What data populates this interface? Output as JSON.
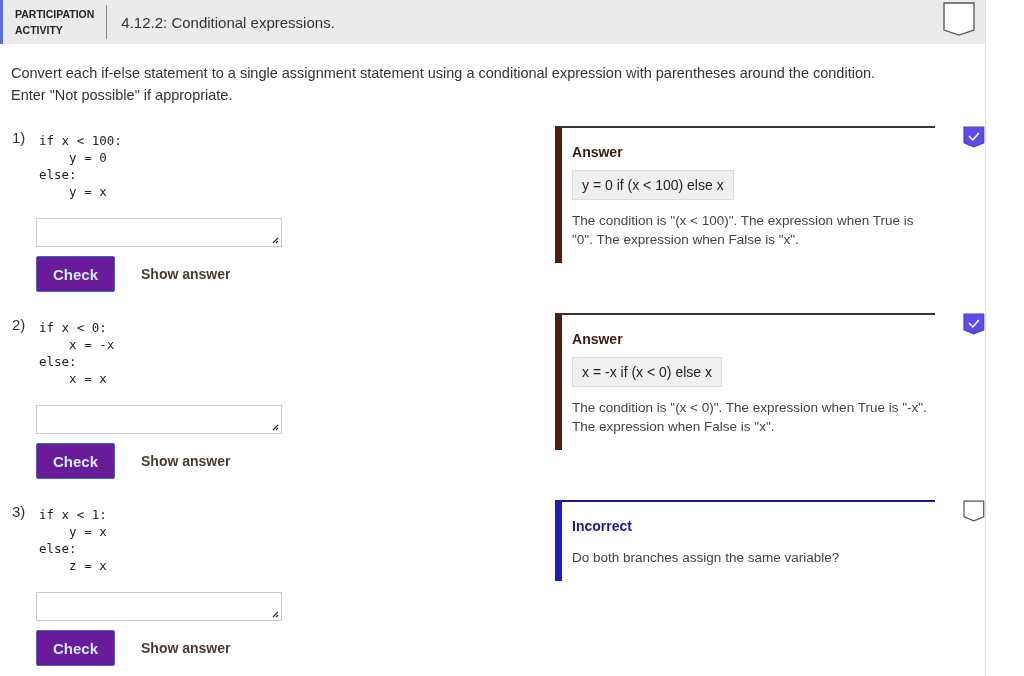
{
  "header": {
    "label_line_1": "PARTICIPATION",
    "label_line_2": "ACTIVITY",
    "title": "4.12.2: Conditional expressions.",
    "completed": false
  },
  "instructions": "Convert each if-else statement to a single assignment statement using a conditional expression with parentheses around the condition. Enter \"Not possible\" if appropriate.",
  "questions": [
    {
      "number": "1)",
      "code": "if x < 100:\n    y = 0\nelse:\n    y = x",
      "check_button": "Check",
      "show_answer": "Show answer",
      "completed": true,
      "feedback": {
        "kind": "answer",
        "heading": "Answer",
        "answer": "y = 0 if (x < 100) else x",
        "explanation": "The condition is \"(x < 100)\". The expression when True is \"0\". The expression when False is \"x\"."
      }
    },
    {
      "number": "2)",
      "code": "if x < 0:\n    x = -x\nelse:\n    x = x",
      "check_button": "Check",
      "show_answer": "Show answer",
      "completed": true,
      "feedback": {
        "kind": "answer",
        "heading": "Answer",
        "answer": "x = -x if (x < 0) else x",
        "explanation": "The condition is \"(x < 0)\". The expression when True is \"-x\". The expression when False is \"x\"."
      }
    },
    {
      "number": "3)",
      "code": "if x < 1:\n    y = x\nelse:\n    z = x",
      "check_button": "Check",
      "show_answer": "Show answer",
      "completed": false,
      "feedback": {
        "kind": "incorrect",
        "heading": "Incorrect",
        "explanation": "Do both branches assign the same variable?"
      }
    }
  ]
}
